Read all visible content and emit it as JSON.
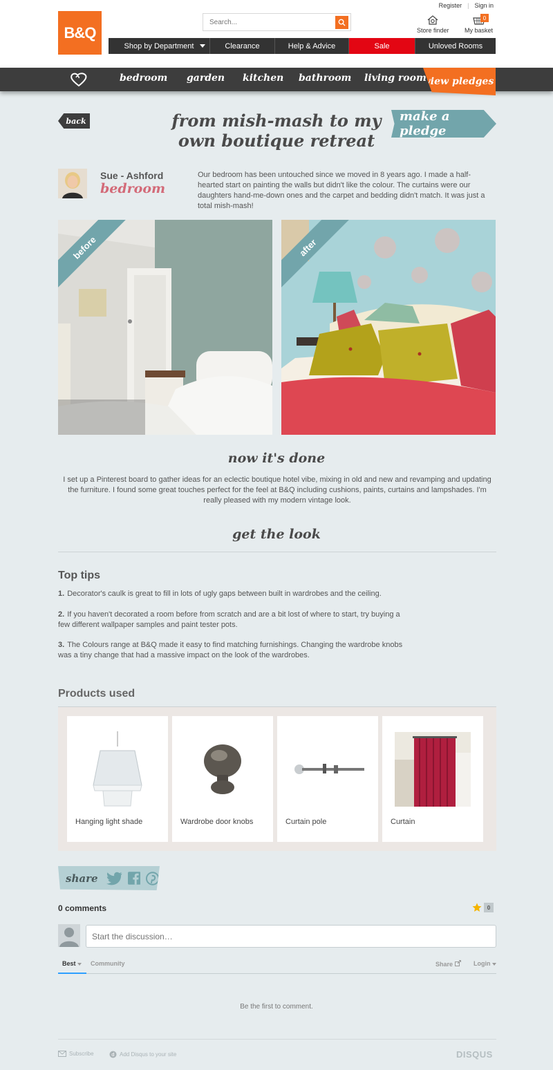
{
  "header": {
    "logo": "B&Q",
    "search_placeholder": "Search...",
    "register": "Register",
    "sign_in": "Sign in",
    "store_finder": "Store finder",
    "basket": "My basket",
    "basket_count": "0",
    "nav": [
      "Shop by Department",
      "Clearance",
      "Help & Advice",
      "Sale",
      "Unloved Rooms"
    ]
  },
  "categories": [
    "bedroom",
    "garden",
    "kitchen",
    "bathroom",
    "living room"
  ],
  "view_pledges": "view pledges",
  "back": "back",
  "title": "from mish-mash to my own boutique retreat",
  "make_pledge": "make a pledge",
  "author": {
    "name": "Sue - Ashford",
    "room": "bedroom",
    "intro": "Our bedroom has been untouched since we moved in 8 years ago. I made a half-hearted start on painting the walls but didn't like the colour. The curtains were our daughters hand-me-down ones and the carpet and bedding didn't match. It was just a total mish-mash!"
  },
  "photos": {
    "before": "before",
    "after": "after"
  },
  "done": {
    "heading": "now it's done",
    "text": "I set up a Pinterest board to gather ideas for an eclectic boutique hotel vibe, mixing in old and new and revamping and updating the furniture. I found some great touches perfect for the feel at B&Q including cushions, paints, curtains and lampshades. I'm really pleased with my modern vintage look."
  },
  "get_the_look": "get the look",
  "tips": {
    "title": "Top tips",
    "items": [
      {
        "num": "1.",
        "text": "Decorator's caulk is great to fill in lots of ugly gaps between built in wardrobes and the ceiling."
      },
      {
        "num": "2.",
        "text": "If you haven't decorated a room before from scratch and are a bit lost of where to start, try buying a few different wallpaper samples and paint tester pots."
      },
      {
        "num": "3.",
        "text": "The Colours range at B&Q made it easy to find matching furnishings. Changing the wardrobe knobs was a tiny change that had a massive impact on the look of the wardrobes."
      }
    ]
  },
  "products": {
    "title": "Products used",
    "items": [
      "Hanging light shade",
      "Wardrobe door knobs",
      "Curtain pole",
      "Curtain"
    ]
  },
  "share": "share",
  "comments": {
    "count": "0 comments",
    "star_count": "0",
    "placeholder": "Start the discussion…",
    "tab_best": "Best",
    "tab_community": "Community",
    "share": "Share",
    "login": "Login",
    "empty": "Be the first to comment.",
    "subscribe": "Subscribe",
    "add_disqus": "Add Disqus to your site",
    "brand": "DISQUS"
  },
  "colors": {
    "orange": "#f36f21",
    "teal": "#72a5ab",
    "dark": "#3d3d3d",
    "sale_red": "#e30613",
    "room_pink": "#d36a78"
  }
}
